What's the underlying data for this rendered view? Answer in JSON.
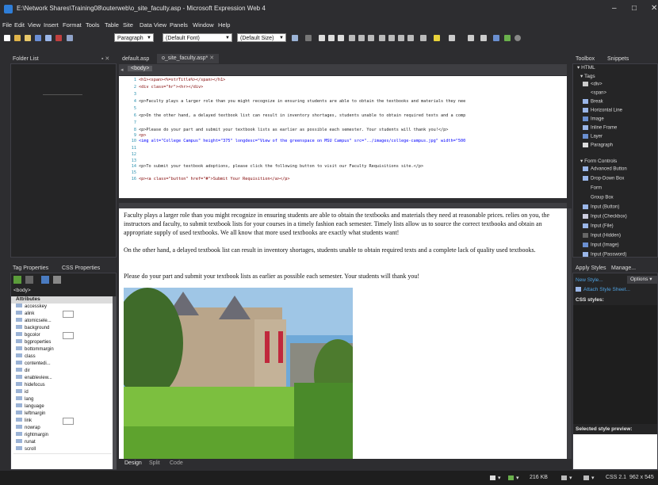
{
  "window": {
    "title": "E:\\Network Shares\\Training08\\outerweb\\o_site_faculty.asp - Microsoft Expression Web 4",
    "controls": {
      "minimize": "–",
      "maximize": "□",
      "close": "✕"
    }
  },
  "menu": [
    "File",
    "Edit",
    "View",
    "Insert",
    "Format",
    "Tools",
    "Table",
    "Site",
    "Data View",
    "Panels",
    "Window",
    "Help"
  ],
  "toolbar": {
    "style": "Paragraph",
    "font": "(Default Font)",
    "size": "(Default Size)"
  },
  "folder_list": {
    "title": "Folder List"
  },
  "tabs": {
    "tab1": "default.asp",
    "tab2": "o_site_faculty.asp*"
  },
  "breadcrumb": "<body>",
  "code": {
    "l1": "<h1><span><%=strTitle%></span></h1>",
    "l2": "<div class=\"hr\"><hr></div>",
    "l4": "<p>Faculty plays a larger role than you might recognize in ensuring students are able to obtain the textbooks and materials they nee",
    "l6": "<p>On the other hand, a delayed textbook list can result in inventory shortages, students unable to obtain required texts and a comp",
    "l8": "<p>Please do your part and submit your textbook lists as earlier as possible each semester.  Your students will thank you!</p>",
    "l9": "<p>",
    "l10": "<img alt=\"College Campus\" height=\"375\" longdesc=\"View of the greenspace on MSU Campus\" src=\"../images/college-campus.jpg\" width=\"500",
    "l14": "<p>To submit your textbook adoptions, please click the following button to visit our Faculty Requisitions site.</p>",
    "l16": "<p><a class=\"button\" href=\"#\">Submit Your Requisition</a></p>"
  },
  "design": {
    "p1": "Faculty plays a larger role than you might recognize in ensuring students are able to obtain the textbooks and materials they need at reasonable prices. relies on you, the instructors and faculty, to submit textbook lists for your courses in a timely fashion each semester. Timely lists allow us to source the correct textbooks and obtain an appropriate supply of used textbooks. We all know that more used textbooks are exactly what students want!",
    "p2": "On the other hand, a delayed textbook list can result in inventory shortages, students unable to obtain required texts and a complete lack of quality used textbooks.",
    "p3": "Please do your part and submit your textbook lists as earlier as possible each semester. Your students will thank you!"
  },
  "view_tabs": [
    "Design",
    "Split",
    "Code"
  ],
  "tag_panel": {
    "tab1": "Tag Properties",
    "tab2": "CSS Properties",
    "element": "<body>",
    "section": "Attributes",
    "attributes": [
      "accesskey",
      "alink",
      "atomicsele...",
      "background",
      "bgcolor",
      "bgproperties",
      "bottommargin",
      "class",
      "contentedi...",
      "dir",
      "enableview...",
      "hidefocus",
      "id",
      "lang",
      "language",
      "leftmargin",
      "link",
      "nowrap",
      "rightmargin",
      "runat",
      "scroll"
    ]
  },
  "toolbox": {
    "tab1": "Toolbox",
    "tab2": "Snippets",
    "html_header": "HTML",
    "tags_header": "Tags",
    "tags": [
      "<div>",
      "<span>",
      "Break",
      "Horizontal Line",
      "Image",
      "Inline Frame",
      "Layer",
      "Paragraph"
    ],
    "form_header": "Form Controls",
    "form_controls": [
      "Advanced Button",
      "Drop-Down Box",
      "Form",
      "Group Box",
      "Input (Button)",
      "Input (Checkbox)",
      "Input (File)",
      "Input (Hidden)",
      "Input (Image)",
      "Input (Password)"
    ]
  },
  "apply_styles": {
    "tab1": "Apply Styles",
    "tab2": "Manage...",
    "new_style": "New Style...",
    "options": "Options",
    "attach": "Attach Style Sheet...",
    "css_styles": "CSS styles:",
    "preview": "Selected style preview:"
  },
  "status": {
    "size": "216 KB",
    "css": "CSS 2.1",
    "dims": "962 x 545"
  }
}
